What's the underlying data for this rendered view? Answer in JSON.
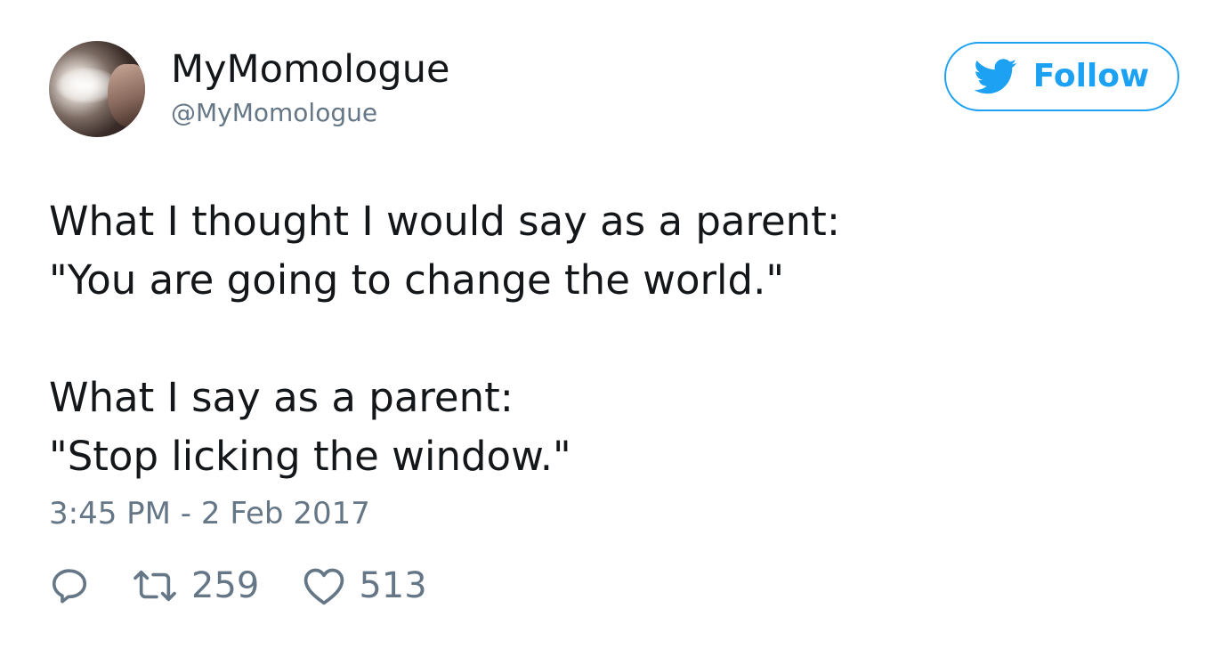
{
  "user": {
    "display_name": "MyMomologue",
    "handle": "@MyMomologue"
  },
  "follow_button": {
    "label": "Follow",
    "icon": "twitter-bird-icon",
    "color": "#1da1f2"
  },
  "tweet": {
    "lines": [
      "What I thought I would say as a parent:",
      "\"You are going to change the world.\"",
      "",
      "What I say as a parent:",
      "\"Stop licking the window.\""
    ],
    "timestamp": "3:45 PM - 2 Feb 2017"
  },
  "actions": {
    "reply": {
      "icon": "reply-icon"
    },
    "retweet": {
      "icon": "retweet-icon",
      "count": "259"
    },
    "like": {
      "icon": "heart-icon",
      "count": "513"
    }
  },
  "colors": {
    "text": "#14171a",
    "secondary": "#657786",
    "accent": "#1da1f2"
  }
}
